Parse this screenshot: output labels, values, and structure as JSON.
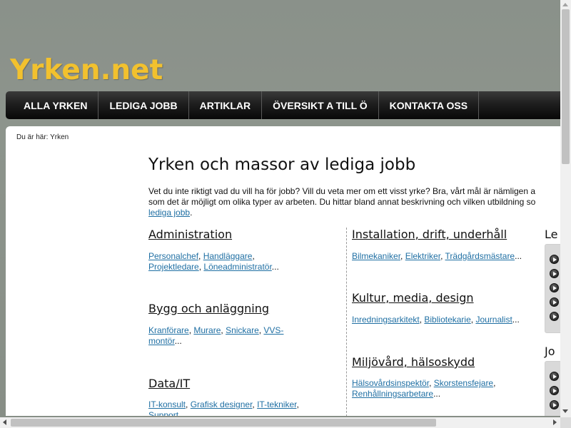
{
  "site": {
    "logo": "Yrken.net"
  },
  "nav": [
    {
      "label": "ALLA YRKEN"
    },
    {
      "label": "LEDIGA JOBB"
    },
    {
      "label": "ARTIKLAR"
    },
    {
      "label": "ÖVERSIKT A TILL Ö"
    },
    {
      "label": "KONTAKTA OSS"
    }
  ],
  "breadcrumb": {
    "prefix": "Du är här: ",
    "current": "Yrken"
  },
  "page": {
    "title": "Yrken och massor av lediga jobb",
    "intro_line1": "Vet du inte riktigt vad du vill ha för jobb? Vill du veta mer om ett visst yrke? Bra, vårt mål är nämligen a",
    "intro_line2": "som det är möjligt om olika typer av arbeten. Du hittar bland annat beskrivning och vilken utbildning so",
    "intro_link": "lediga jobb",
    "intro_end": "."
  },
  "categories": {
    "administration": {
      "title": "Administration",
      "links": [
        "Personalchef",
        "Handläggare",
        "Projektledare",
        "Löneadministratör"
      ]
    },
    "bygg": {
      "title": "Bygg och anläggning",
      "links": [
        "Kranförare",
        "Murare",
        "Snickare",
        "VVS-",
        "montör"
      ]
    },
    "data": {
      "title": "Data/IT",
      "links": [
        "IT-konsult",
        "Grafisk designer",
        "IT-tekniker",
        "Support"
      ]
    },
    "installation": {
      "title": "Installation, drift, underhåll",
      "links": [
        "Bilmekaniker",
        "Elektriker",
        "Trädgårdsmästare"
      ]
    },
    "kultur": {
      "title": "Kultur, media, design",
      "links": [
        "Inredningsarkitekt",
        "Bibliotekarie",
        "Journalist"
      ]
    },
    "miljo": {
      "title": "Miljövård, hälsoskydd",
      "links": [
        "Hälsovårdsinspektör",
        "Skorstensfejare",
        "Renhållningsarbetare"
      ]
    }
  },
  "punct": {
    "comma": ", ",
    "ellipsis": "..."
  },
  "sidebar": {
    "head1": "Le",
    "head2": "Jo"
  },
  "colors": {
    "logo": "#f2c12e",
    "link": "#1f6fa3",
    "nav_bg": "#1e1e1e"
  }
}
